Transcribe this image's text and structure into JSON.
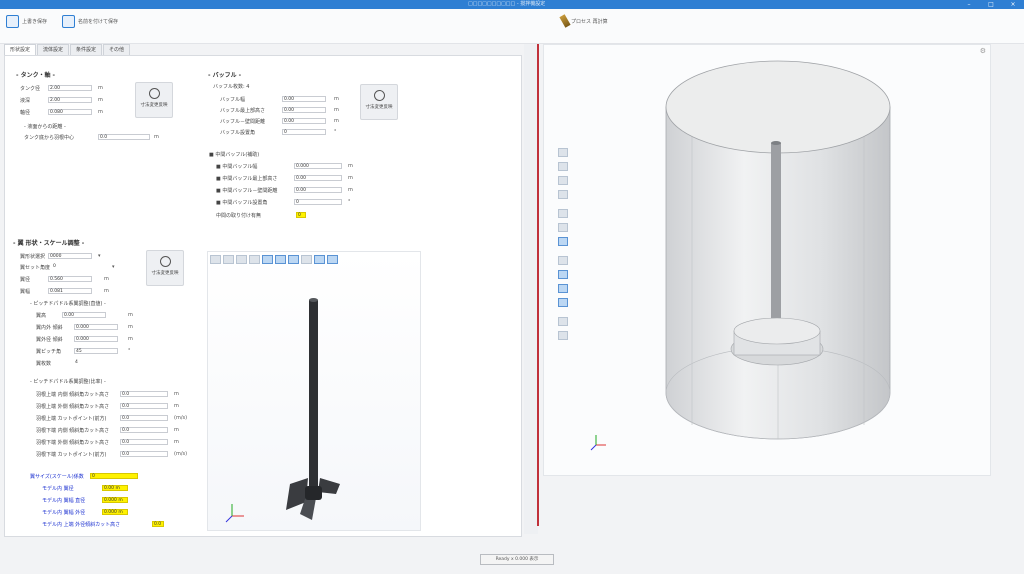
{
  "window": {
    "title": "□□□□□□□□□□ - 撹拌機設定"
  },
  "toolbar": {
    "button1": "上書き保存",
    "button2": "名前を付けて保存",
    "right_button": "プロセス 再計算"
  },
  "tabs": [
    "形状設定",
    "流体設定",
    "条件設定",
    "その他"
  ],
  "tank": {
    "title": "- タンク・軸 -",
    "fields": [
      {
        "label": "タンク径",
        "value": "2.00",
        "unit": "m"
      },
      {
        "label": "液深",
        "value": "2.00",
        "unit": "m"
      },
      {
        "label": "軸径",
        "value": "0.080",
        "unit": "m"
      }
    ],
    "sub_title": "- 液面からの距離 -",
    "sub_field": {
      "label": "タンク底から羽根中心",
      "value": "0.0",
      "unit": "m"
    },
    "calc_label": "寸法変更反映"
  },
  "baffle": {
    "title": "- バッフル -",
    "count_label": "バッフル枚数: 4",
    "fields": [
      {
        "label": "バッフル幅",
        "value": "0.00",
        "unit": "m"
      },
      {
        "label": "バッフル最上部高さ",
        "value": "0.00",
        "unit": "m"
      },
      {
        "label": "バッフル－壁間距離",
        "value": "0.00",
        "unit": "m"
      },
      {
        "label": "バッフル設置角",
        "value": "0",
        "unit": "°"
      }
    ],
    "sub_title": "■ 中間バッフル(補助)",
    "sub_fields": [
      {
        "label": "■ 中間バッフル幅",
        "value": "0.000",
        "unit": "m"
      },
      {
        "label": "■ 中間バッフル最上部高さ",
        "value": "0.00",
        "unit": "m"
      },
      {
        "label": "■ 中間バッフル－壁間距離",
        "value": "0.00",
        "unit": "m"
      },
      {
        "label": "■ 中間バッフル設置角",
        "value": "0",
        "unit": "°"
      }
    ],
    "yellow_field": {
      "label": "中間の取り付け有無",
      "value": "0"
    },
    "calc_label": "寸法変更反映"
  },
  "impeller": {
    "title": "- 翼 形状・スケール調整 -",
    "fields": [
      {
        "label": "翼形状選択",
        "value": "0000",
        "unit": ""
      },
      {
        "label": "翼セット角度",
        "value": "0",
        "unit": ""
      },
      {
        "label": "翼径",
        "value": "0.560",
        "unit": "m"
      },
      {
        "label": "翼幅",
        "value": "0.081",
        "unit": "m"
      }
    ],
    "sub1_title": "- ピッチドパドル系翼調整(直値) -",
    "sub1_fields": [
      {
        "label": "翼高",
        "value": "0.00",
        "unit": "m"
      },
      {
        "label": "翼内外 傾斜",
        "value": "0.000",
        "unit": "m"
      },
      {
        "label": "翼外径 傾斜",
        "value": "0.000",
        "unit": "m"
      },
      {
        "label": "翼ピッチ角",
        "value": "45",
        "unit": "°"
      },
      {
        "label": "翼枚数",
        "value": "4",
        "unit": ""
      }
    ],
    "sub2_title": "- ピッチドパドル系翼調整(比率) -",
    "sub2_fields": [
      {
        "label": "羽根上端 内側 傾斜角カット高さ",
        "value": "0.0",
        "unit": "m"
      },
      {
        "label": "羽根上端 外側 傾斜角カット高さ",
        "value": "0.0",
        "unit": "m"
      },
      {
        "label": "羽根上端 カットポイント(前方)",
        "value": "0.0",
        "unit": "(m/s)"
      },
      {
        "label": "羽根下端 内側 傾斜角カット高さ",
        "value": "0.0",
        "unit": "m"
      },
      {
        "label": "羽根下端 外側 傾斜角カット高さ",
        "value": "0.0",
        "unit": "m"
      },
      {
        "label": "羽根下端 カットポイント(前方)",
        "value": "0.0",
        "unit": "(m/s)"
      }
    ],
    "blue_fields": [
      {
        "label": "翼サイズ(スケール)係数",
        "value": "0",
        "yellow": true
      },
      {
        "label": "モデル内 翼径",
        "value": "0.00 m",
        "yellow": true
      },
      {
        "label": "モデル内 翼幅 直径",
        "value": "0.000 m",
        "yellow": true
      },
      {
        "label": "モデル内 翼幅 外径",
        "value": "0.000 m",
        "yellow": true
      },
      {
        "label": "モデル内 上端 外径傾斜カット高さ",
        "value": "0.0",
        "yellow": true
      }
    ],
    "calc_label": "寸法変更反映"
  },
  "status": {
    "text": "Ready  x 0.000  表示"
  },
  "colors": {
    "accent": "#2f7fd3",
    "yellow": "#fff200",
    "blue_text": "#1a2fd0",
    "divider": "#c0313a"
  }
}
